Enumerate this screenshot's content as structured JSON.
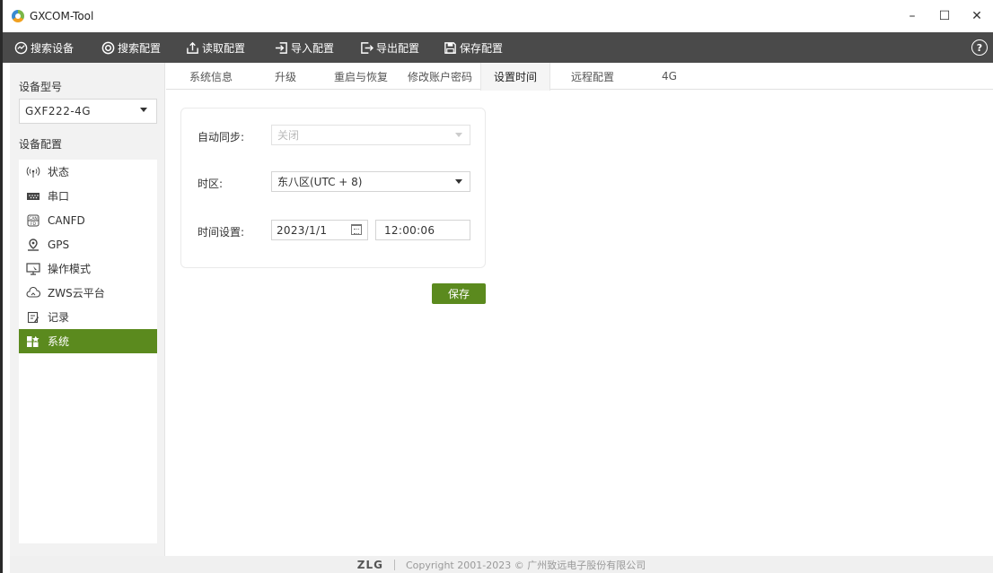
{
  "window": {
    "title": "GXCOM-Tool",
    "controls": {
      "minimize": "–",
      "maximize": "☐",
      "close": "✕"
    }
  },
  "toolbar": {
    "items": [
      {
        "label": "搜索设备",
        "icon": "search-device-icon"
      },
      {
        "label": "搜索配置",
        "icon": "search-config-icon"
      },
      {
        "label": "读取配置",
        "icon": "read-config-icon"
      },
      {
        "label": "导入配置",
        "icon": "import-config-icon"
      },
      {
        "label": "导出配置",
        "icon": "export-config-icon"
      },
      {
        "label": "保存配置",
        "icon": "save-config-icon"
      }
    ],
    "help": "?"
  },
  "sidebar": {
    "device_model_label": "设备型号",
    "device_model_value": "GXF222-4G",
    "device_config_label": "设备配置",
    "items": [
      {
        "label": "状态",
        "icon": "signal-icon"
      },
      {
        "label": "串口",
        "icon": "serial-port-icon"
      },
      {
        "label": "CANFD",
        "icon": "canfd-icon"
      },
      {
        "label": "GPS",
        "icon": "gps-icon"
      },
      {
        "label": "操作模式",
        "icon": "operation-mode-icon"
      },
      {
        "label": "ZWS云平台",
        "icon": "cloud-icon"
      },
      {
        "label": "记录",
        "icon": "record-icon"
      },
      {
        "label": "系统",
        "icon": "system-icon",
        "active": true
      }
    ]
  },
  "tabs": [
    {
      "label": "系统信息"
    },
    {
      "label": "升级"
    },
    {
      "label": "重启与恢复"
    },
    {
      "label": "修改账户密码"
    },
    {
      "label": "设置时间",
      "active": true
    },
    {
      "label": "远程配置"
    },
    {
      "label": "4G"
    }
  ],
  "form": {
    "auto_sync_label": "自动同步:",
    "auto_sync_value": "关闭",
    "timezone_label": "时区:",
    "timezone_value": "东八区(UTC + 8)",
    "time_setting_label": "时间设置:",
    "date_value": "2023/1/1",
    "time_value": "12:00:06",
    "save_label": "保存"
  },
  "footer": {
    "brand": "ZLG",
    "copyright": "Copyright  2001-2023 © 广州致远电子股份有限公司"
  },
  "colors": {
    "accent_green": "#5b8a1e",
    "toolbar_bg": "#4a4a4a"
  }
}
